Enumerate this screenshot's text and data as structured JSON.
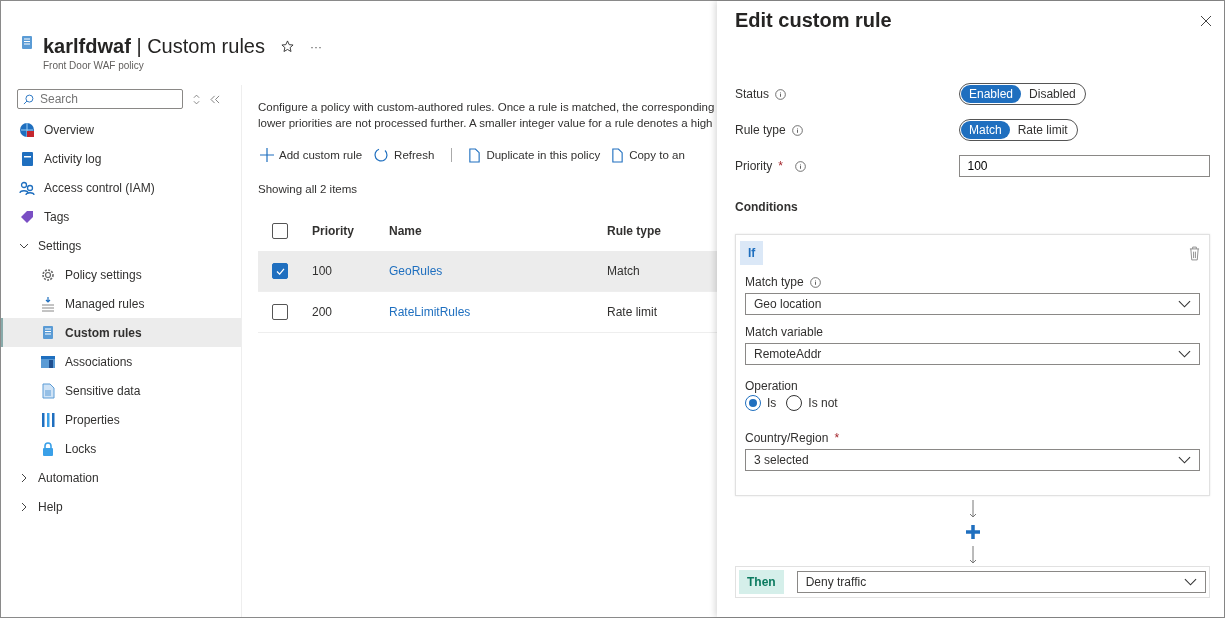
{
  "header": {
    "resource": "karlfdwaf",
    "separator": "|",
    "page": "Custom rules",
    "subtitle": "Front Door WAF policy",
    "more": "···"
  },
  "sidebar": {
    "search": {
      "placeholder": "Search"
    },
    "items": [
      {
        "label": "Overview",
        "selected": false
      },
      {
        "label": "Activity log",
        "selected": false
      },
      {
        "label": "Access control (IAM)",
        "selected": false
      },
      {
        "label": "Tags",
        "selected": false
      },
      {
        "label": "Settings",
        "selected": false,
        "expanded": true,
        "children": [
          {
            "label": "Policy settings",
            "selected": false
          },
          {
            "label": "Managed rules",
            "selected": false
          },
          {
            "label": "Custom rules",
            "selected": true
          },
          {
            "label": "Associations",
            "selected": false
          },
          {
            "label": "Sensitive data",
            "selected": false
          },
          {
            "label": "Properties",
            "selected": false
          },
          {
            "label": "Locks",
            "selected": false
          }
        ]
      },
      {
        "label": "Automation",
        "selected": false,
        "expanded": false
      },
      {
        "label": "Help",
        "selected": false,
        "expanded": false
      }
    ]
  },
  "description": [
    "Configure a policy with custom-authored rules. Once a rule is matched, the corresponding",
    "lower priorities are not processed further. A smaller integer value for a rule denotes a high"
  ],
  "toolbar": [
    {
      "kind": "add",
      "label": "Add custom rule"
    },
    {
      "kind": "refresh",
      "label": "Refresh"
    },
    {
      "kind": "copy",
      "label": "Duplicate in this policy"
    },
    {
      "kind": "copy",
      "label": "Copy to an"
    }
  ],
  "item_count": "Showing all 2 items",
  "table": {
    "all_checked": false,
    "columns": [
      "Priority",
      "Name",
      "Rule type"
    ],
    "rows": [
      {
        "priority": "100",
        "name": "GeoRules",
        "rule_type": "Match",
        "selected": true
      },
      {
        "priority": "200",
        "name": "RateLimitRules",
        "rule_type": "Rate limit",
        "selected": false
      }
    ]
  },
  "panel": {
    "title": "Edit custom rule",
    "status": {
      "label": "Status",
      "options": [
        {
          "label": "Enabled",
          "selected": true
        },
        {
          "label": "Disabled",
          "selected": false
        }
      ]
    },
    "rule_type": {
      "label": "Rule type",
      "options": [
        {
          "label": "Match",
          "selected": true
        },
        {
          "label": "Rate limit",
          "selected": false
        }
      ]
    },
    "priority": {
      "label": "Priority",
      "required_mark": "*",
      "value": "100"
    },
    "conditions_heading": "Conditions",
    "condition": {
      "badge": "If",
      "match_type": {
        "label": "Match type",
        "value": "Geo location"
      },
      "match_variable": {
        "label": "Match variable",
        "value": "RemoteAddr"
      },
      "operation": {
        "label": "Operation",
        "options": [
          {
            "label": "Is",
            "selected": true
          },
          {
            "label": "Is not",
            "selected": false
          }
        ]
      },
      "country": {
        "label": "Country/Region",
        "required_mark": "*",
        "value": "3 selected"
      }
    },
    "then": {
      "badge": "Then",
      "value": "Deny traffic"
    }
  }
}
